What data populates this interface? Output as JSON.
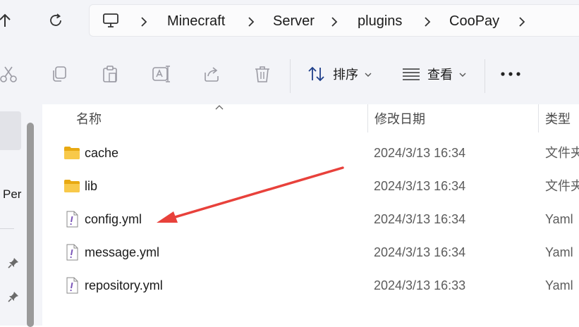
{
  "breadcrumb": {
    "items": [
      "Minecraft",
      "Server",
      "plugins",
      "CooPay"
    ]
  },
  "toolbar": {
    "sort_label": "排序",
    "view_label": "查看"
  },
  "navpane": {
    "partial_item_label": "Per"
  },
  "columns": {
    "name": "名称",
    "date_modified": "修改日期",
    "type": "类型"
  },
  "files": [
    {
      "name": "cache",
      "date": "2024/3/13 16:34",
      "type": "文件夹",
      "icon": "folder-icon"
    },
    {
      "name": "lib",
      "date": "2024/3/13 16:34",
      "type": "文件夹",
      "icon": "folder-icon"
    },
    {
      "name": "config.yml",
      "date": "2024/3/13 16:34",
      "type": "Yaml",
      "icon": "yaml-file-icon"
    },
    {
      "name": "message.yml",
      "date": "2024/3/13 16:34",
      "type": "Yaml",
      "icon": "yaml-file-icon"
    },
    {
      "name": "repository.yml",
      "date": "2024/3/13 16:33",
      "type": "Yaml",
      "icon": "yaml-file-icon"
    }
  ],
  "colors": {
    "chrome_bg": "#f3f4f8",
    "folder": "#f8c94a",
    "arrow": "#e8413b"
  }
}
